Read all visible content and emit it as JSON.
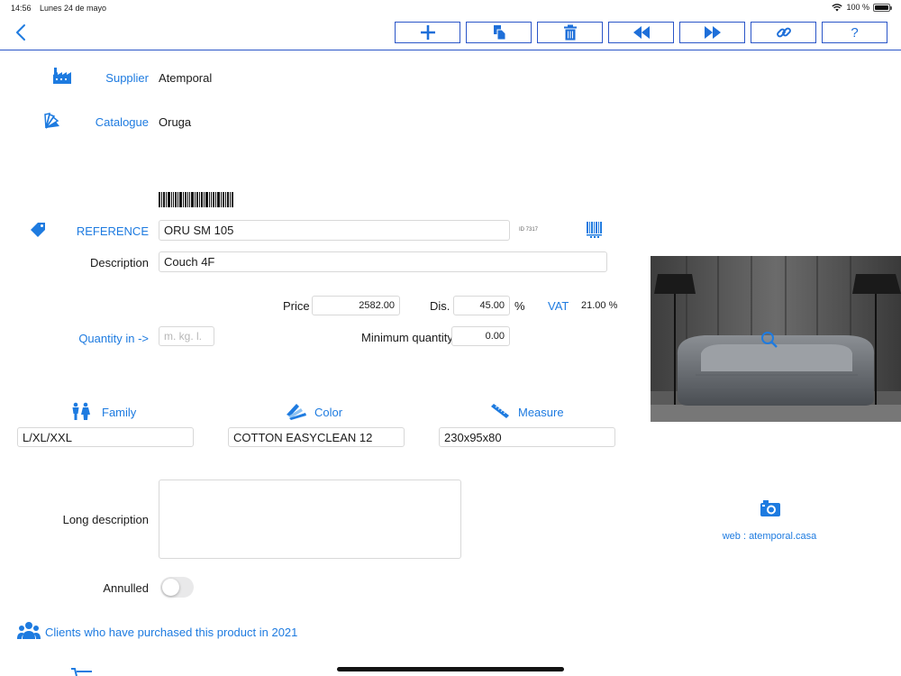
{
  "status": {
    "time": "14:56",
    "date": "Lunes 24 de mayo",
    "battery": "100 %"
  },
  "toolbar": {
    "buttons": [
      {
        "name": "add-button",
        "icon": "plus-icon"
      },
      {
        "name": "duplicate-button",
        "icon": "copy-icon"
      },
      {
        "name": "delete-button",
        "icon": "trash-icon"
      },
      {
        "name": "previous-button",
        "icon": "rewind-icon"
      },
      {
        "name": "next-button",
        "icon": "fast-forward-icon"
      },
      {
        "name": "link-button",
        "icon": "link-icon"
      },
      {
        "name": "help-button",
        "icon": "question-icon",
        "label": "?"
      }
    ]
  },
  "supplier": {
    "label": "Supplier",
    "value": "Atemporal",
    "icon": "factory-icon"
  },
  "catalogue": {
    "label": "Catalogue",
    "value": "Oruga",
    "icon": "swatch-fan-icon"
  },
  "reference": {
    "label": "REFERENCE",
    "value": "ORU SM 105",
    "id": "ID 7317",
    "icon": "tag-icon"
  },
  "description": {
    "label": "Description",
    "value": "Couch 4F"
  },
  "price": {
    "label": "Price",
    "value": "2582.00"
  },
  "discount": {
    "label": "Dis.",
    "value": "45.00",
    "unit": "%"
  },
  "vat": {
    "label": "VAT",
    "value": "21.00 %"
  },
  "quantity_in": {
    "label": "Quantity in ->",
    "placeholder": "m. kg. l."
  },
  "minimum_quantity": {
    "label": "Minimum quantity",
    "value": "0.00"
  },
  "family": {
    "label": "Family",
    "value": "L/XL/XXL",
    "icon": "family-icon"
  },
  "color": {
    "label": "Color",
    "value": "COTTON EASYCLEAN 12",
    "icon": "color-swatch-icon"
  },
  "measure": {
    "label": "Measure",
    "value": "230x95x80",
    "icon": "ruler-icon"
  },
  "long_description": {
    "label": "Long description",
    "value": ""
  },
  "annulled": {
    "label": "Annulled",
    "on": false
  },
  "web": {
    "text": "web : atemporal.casa",
    "icon": "camera-icon"
  },
  "clients": {
    "text": "Clients who have purchased this product in 2021",
    "icon": "group-icon"
  },
  "colors": {
    "accent": "#1e7be0",
    "toolbar_border": "#2a55c8"
  }
}
